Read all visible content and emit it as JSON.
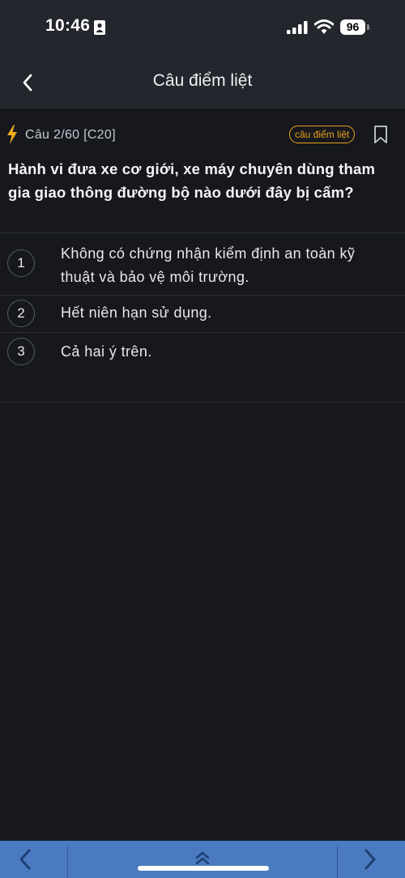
{
  "status_bar": {
    "time": "10:46",
    "battery": "96"
  },
  "nav": {
    "title": "Câu điểm liệt"
  },
  "question": {
    "number": "Câu 2/60 [C20]",
    "tag": "câu điểm liệt",
    "text": "Hành vi đưa xe cơ giới, xe máy chuyên dùng tham gia giao thông đường bộ nào dưới đây bị cấm?",
    "answers": [
      {
        "number": "1",
        "text": "Không có chứng nhận kiểm định an toàn kỹ thuật và bảo vệ môi trường."
      },
      {
        "number": "2",
        "text": "Hết niên hạn sử dụng."
      },
      {
        "number": "3",
        "text": "Cả hai ý trên."
      }
    ]
  },
  "colors": {
    "background": "#16181d",
    "header": "#24262d",
    "accent_orange": "#e8a11a",
    "bottom_bar": "#4a7bc1"
  },
  "icons": [
    "person-icon",
    "signal-icon",
    "wifi-icon",
    "back-icon",
    "bolt-icon",
    "bookmark-icon",
    "chevron-left-icon",
    "double-chevron-up-icon",
    "chevron-right-icon"
  ]
}
